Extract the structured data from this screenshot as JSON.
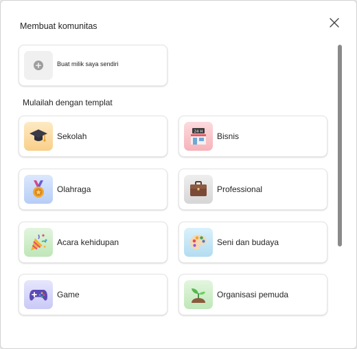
{
  "dialog": {
    "title": "Membuat komunitas",
    "close_icon": "close-icon"
  },
  "create_own": {
    "label": "Buat milik saya sendiri",
    "icon": "plus-circle-icon"
  },
  "templates_heading": "Mulailah dengan templat",
  "templates": [
    {
      "label": "Sekolah",
      "icon": "graduation-cap-icon",
      "tile_color": "#fde2b0"
    },
    {
      "label": "Bisnis",
      "icon": "store-icon",
      "tile_color": "#fbd0d3"
    },
    {
      "label": "Olahraga",
      "icon": "medal-icon",
      "tile_color": "#cfe0fb"
    },
    {
      "label": "Professional",
      "icon": "briefcase-icon",
      "tile_color": "#e4e4e4"
    },
    {
      "label": "Acara kehidupan",
      "icon": "party-popper-icon",
      "tile_color": "#d5efd0"
    },
    {
      "label": "Seni dan budaya",
      "icon": "palette-icon",
      "tile_color": "#cde9f6"
    },
    {
      "label": "Game",
      "icon": "game-controller-icon",
      "tile_color": "#dcdcfa"
    },
    {
      "label": "Organisasi pemuda",
      "icon": "sprout-icon",
      "tile_color": "#d7f0d3"
    }
  ]
}
